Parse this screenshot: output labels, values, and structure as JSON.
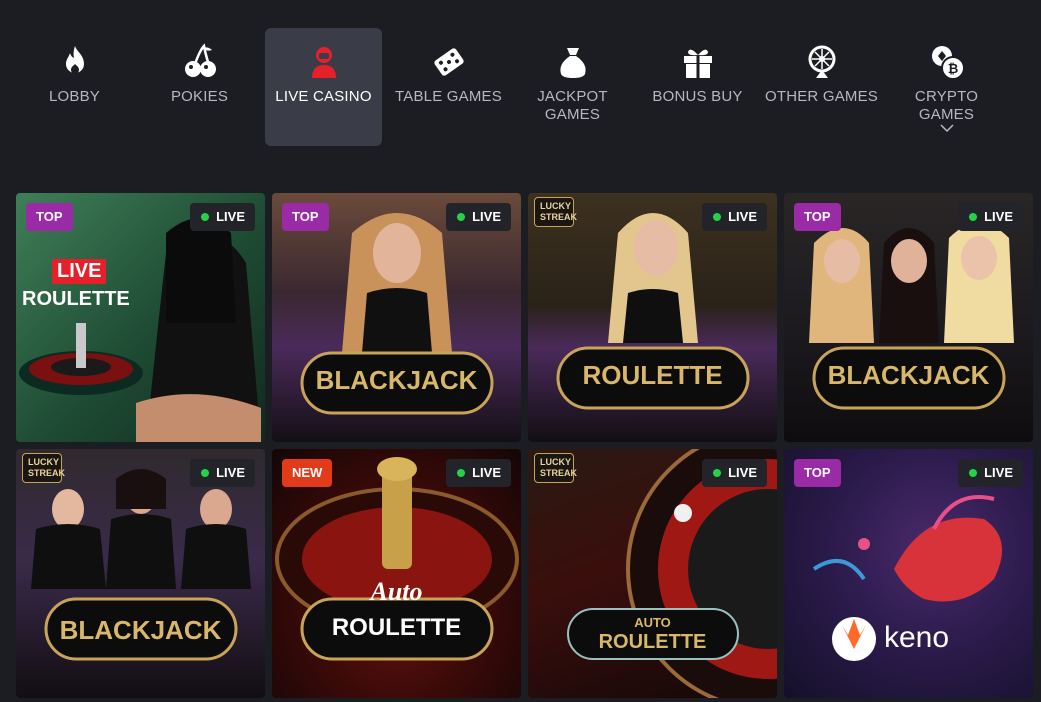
{
  "nav": {
    "items": [
      {
        "label": "LOBBY",
        "icon": "fire-icon"
      },
      {
        "label": "POKIES",
        "icon": "cherries-icon"
      },
      {
        "label": "LIVE CASINO",
        "icon": "dealer-icon",
        "active": true
      },
      {
        "label": "TABLE GAMES",
        "icon": "dice-card-icon"
      },
      {
        "label": "JACKPOT GAMES",
        "icon": "money-bag-icon"
      },
      {
        "label": "BONUS BUY",
        "icon": "gift-icon"
      },
      {
        "label": "OTHER GAMES",
        "icon": "wheel-icon"
      },
      {
        "label": "CRYPTO GAMES",
        "icon": "crypto-coins-icon",
        "has_dropdown": true
      }
    ]
  },
  "games": [
    {
      "badge": "TOP",
      "live": "LIVE",
      "title_top": "LIVE",
      "title_main": "ROULETTE"
    },
    {
      "badge": "TOP",
      "live": "LIVE",
      "title_main": "BLACKJACK"
    },
    {
      "badge": "LUCKY STREAK",
      "live": "LIVE",
      "title_main": "ROULETTE"
    },
    {
      "badge": "TOP",
      "live": "LIVE",
      "title_main": "BLACKJACK"
    },
    {
      "badge": "LUCKY STREAK",
      "live": "LIVE",
      "title_main": "BLACKJACK"
    },
    {
      "badge": "NEW",
      "live": "LIVE",
      "title_top": "Auto",
      "title_main": "ROULETTE"
    },
    {
      "badge": "LUCKY STREAK",
      "live": "LIVE",
      "title_top": "AUTO",
      "title_main": "ROULETTE"
    },
    {
      "badge": "TOP",
      "live": "LIVE",
      "title_main": "keno"
    }
  ],
  "colors": {
    "background": "#1c1d22",
    "nav_active": "#3a3d47",
    "badge_top": "#9b2aa6",
    "badge_new": "#e23b1b",
    "live_dot": "#27d04b",
    "accent_red": "#e5202a"
  }
}
